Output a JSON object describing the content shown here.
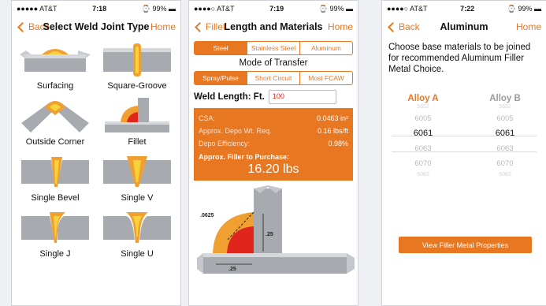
{
  "colors": {
    "accent": "#e87722",
    "weld": "#f0a030",
    "steel": "#a7abb0"
  },
  "screen1": {
    "status": {
      "carrier": "●●●●● AT&T",
      "time": "7:18",
      "battery": "99%"
    },
    "nav": {
      "back": "Back",
      "title": "Select Weld Joint Type",
      "right": "Home"
    },
    "joints": [
      {
        "label": "Surfacing",
        "icon": "surfacing-joint-icon"
      },
      {
        "label": "Square-Groove",
        "icon": "square-groove-joint-icon"
      },
      {
        "label": "Outside Corner",
        "icon": "outside-corner-joint-icon"
      },
      {
        "label": "Fillet",
        "icon": "fillet-joint-icon"
      },
      {
        "label": "Single Bevel",
        "icon": "single-bevel-joint-icon"
      },
      {
        "label": "Single V",
        "icon": "single-v-joint-icon"
      },
      {
        "label": "Single J",
        "icon": "single-j-joint-icon"
      },
      {
        "label": "Single U",
        "icon": "single-u-joint-icon"
      }
    ]
  },
  "screen2": {
    "status": {
      "carrier": "●●●●○ AT&T",
      "time": "7:19",
      "battery": "99%"
    },
    "nav": {
      "back": "Fillet",
      "title": "Length and Materials",
      "right": "Home"
    },
    "materials": [
      "Steel",
      "Stainless Steel",
      "Aluminum"
    ],
    "materials_selected": 0,
    "mode_title": "Mode of Transfer",
    "modes": [
      "Spray/Pulse",
      "Short Circuit",
      "Most FCAW"
    ],
    "modes_selected": 0,
    "weld_length_label": "Weld Length: Ft.",
    "weld_length_value": "100",
    "results": [
      {
        "label": "CSA:",
        "value": "0.0463 in²"
      },
      {
        "label": "Approx. Depo Wt. Req.",
        "value": "0.16 lbs/ft"
      },
      {
        "label": "Depo Efficiency:",
        "value": "0.98%"
      }
    ],
    "filler_label": "Approx. Filler to Purchase:",
    "filler_value": "16.20 lbs",
    "diagram": {
      "dim_a": ".0625",
      "dim_b": ".25",
      "dim_c": ".25"
    }
  },
  "screen3": {
    "status": {
      "carrier": "●●●●○ AT&T",
      "time": "7:22",
      "battery": "99%"
    },
    "nav": {
      "back": "Back",
      "title": "Aluminum",
      "right": "Home"
    },
    "intro": "Choose base materials to be joined for recommended Aluminum Filler Metal Choice.",
    "col_a_title": "Alloy A",
    "col_b_title": "Alloy B",
    "alloys": [
      "5652",
      "6005",
      "6061",
      "6063",
      "6070",
      "6082"
    ],
    "selected_index": 2,
    "button": "View Filler Metal Properties"
  }
}
